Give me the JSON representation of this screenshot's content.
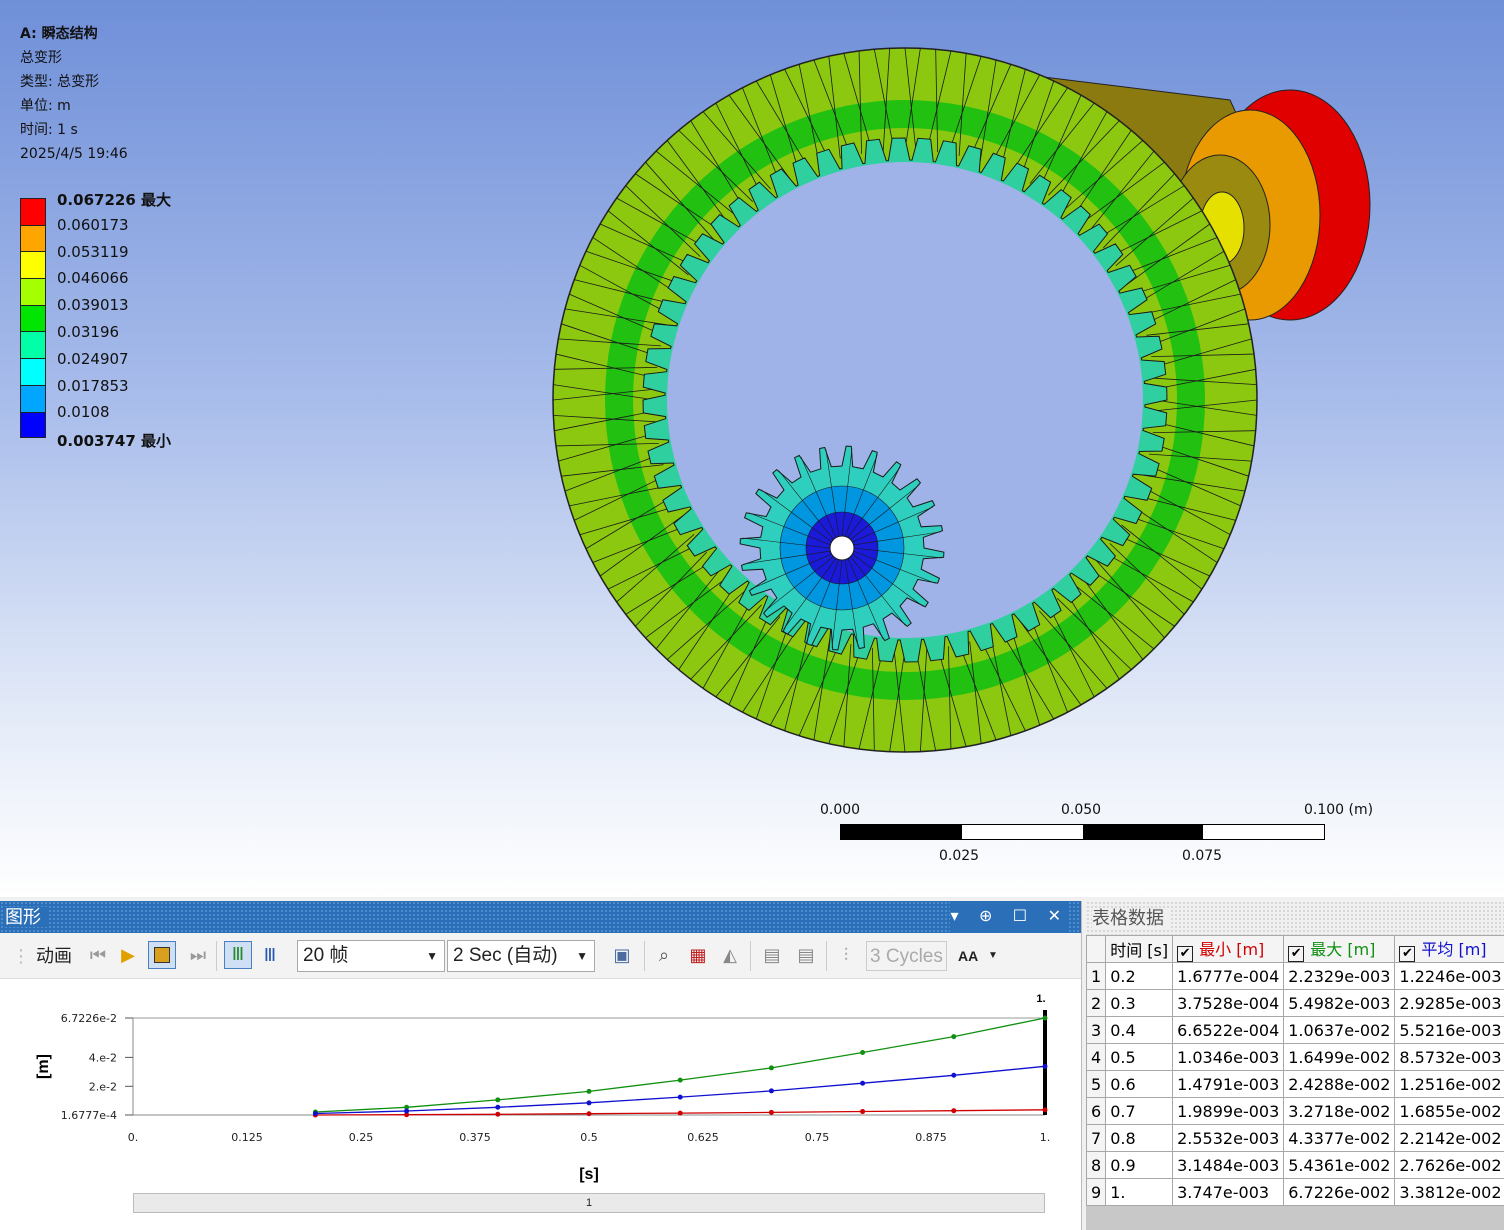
{
  "viewport": {
    "info": {
      "title": "A: 瞬态结构",
      "result": "总变形",
      "type": "类型: 总变形",
      "unit": "单位: m",
      "time": "时间: 1 s",
      "date": "2025/4/5 19:46"
    },
    "legend": {
      "colors": [
        "#ff0000",
        "#ffa500",
        "#ffff00",
        "#a6ff00",
        "#00e600",
        "#00ffa6",
        "#00ffff",
        "#00a6ff",
        "#0000ff"
      ],
      "labels": [
        "0.067226 最大",
        "0.060173",
        "0.053119",
        "0.046066",
        "0.039013",
        "0.03196",
        "0.024907",
        "0.017853",
        "0.0108",
        "0.003747 最小"
      ]
    },
    "scale": {
      "top_labels": [
        "0.000",
        "0.050",
        "0.100 (m)"
      ],
      "bottom_labels": [
        "0.025",
        "0.075"
      ]
    }
  },
  "graph_panel": {
    "title": "图形",
    "controls": "▾ ⊕ ☐ ✕",
    "toolbar": {
      "animation_label": "动画",
      "frames": "20 帧",
      "duration": "2 Sec (自动)",
      "cycles": "3 Cycles",
      "aa": "AA"
    },
    "chart_data": {
      "type": "line",
      "ylabel": "[m]",
      "xlabel": "[s]",
      "x": [
        0.2,
        0.3,
        0.4,
        0.5,
        0.6,
        0.7,
        0.8,
        0.9,
        1.0
      ],
      "xlim": [
        0,
        1
      ],
      "ylim": [
        0.00016777,
        0.067226
      ],
      "xticks": [
        "0.",
        "0.125",
        "0.25",
        "0.375",
        "0.5",
        "0.625",
        "0.75",
        "0.875",
        "1."
      ],
      "yticks": [
        "6.7226e-2",
        "4.e-2",
        "2.e-2",
        "1.6777e-4"
      ],
      "marker_label": "1.",
      "series": [
        {
          "name": "最小",
          "color": "#d00000",
          "values": [
            0.00016777,
            0.00037528,
            0.00066522,
            0.0010346,
            0.0014791,
            0.0019899,
            0.0025532,
            0.0031484,
            0.003747
          ]
        },
        {
          "name": "最大",
          "color": "#109010",
          "values": [
            0.0022329,
            0.0054982,
            0.010637,
            0.016499,
            0.024288,
            0.032718,
            0.043377,
            0.054361,
            0.067226
          ]
        },
        {
          "name": "平均",
          "color": "#1010d0",
          "values": [
            0.0012246,
            0.0029285,
            0.0055216,
            0.0085732,
            0.012516,
            0.016855,
            0.022142,
            0.027626,
            0.033812
          ]
        }
      ]
    },
    "scrollbar_label": "1"
  },
  "table_panel": {
    "title": "表格数据",
    "headers": [
      "时间 [s]",
      "最小 [m]",
      "最大 [m]",
      "平均 [m]"
    ],
    "header_colors": [
      "#222222",
      "#d00000",
      "#109010",
      "#1010d0"
    ],
    "rows": [
      [
        "1",
        "0.2",
        "1.6777e-004",
        "2.2329e-003",
        "1.2246e-003"
      ],
      [
        "2",
        "0.3",
        "3.7528e-004",
        "5.4982e-003",
        "2.9285e-003"
      ],
      [
        "3",
        "0.4",
        "6.6522e-004",
        "1.0637e-002",
        "5.5216e-003"
      ],
      [
        "4",
        "0.5",
        "1.0346e-003",
        "1.6499e-002",
        "8.5732e-003"
      ],
      [
        "5",
        "0.6",
        "1.4791e-003",
        "2.4288e-002",
        "1.2516e-002"
      ],
      [
        "6",
        "0.7",
        "1.9899e-003",
        "3.2718e-002",
        "1.6855e-002"
      ],
      [
        "7",
        "0.8",
        "2.5532e-003",
        "4.3377e-002",
        "2.2142e-002"
      ],
      [
        "8",
        "0.9",
        "3.1484e-003",
        "5.4361e-002",
        "2.7626e-002"
      ],
      [
        "9",
        "1.",
        "3.747e-003",
        "6.7226e-002",
        "3.3812e-002"
      ]
    ]
  }
}
